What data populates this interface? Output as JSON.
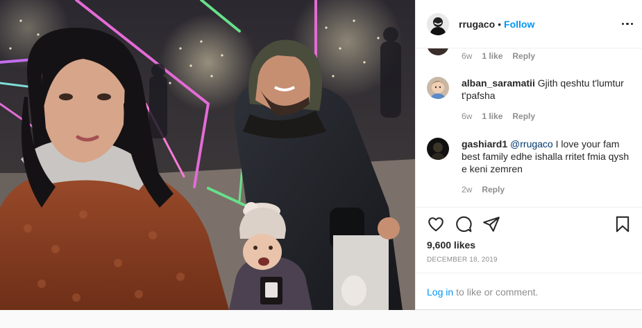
{
  "post": {
    "author": "rrugaco",
    "separator": "•",
    "follow_label": "Follow",
    "more_icon": "more-horizontal-icon"
  },
  "partial_comment": {
    "age": "6w",
    "likes": "1 like",
    "reply": "Reply"
  },
  "comments": [
    {
      "user": "alban_saramatii",
      "mention": "",
      "text": "Gjith qeshtu t'lumtur t'pafsha",
      "age": "6w",
      "likes": "1 like",
      "reply": "Reply"
    },
    {
      "user": "gashiard1",
      "mention": "@rrugaco",
      "text": "I love your fam best family edhe ishalla rritet fmia qysh e keni zemren",
      "age": "2w",
      "likes": "",
      "reply": "Reply"
    }
  ],
  "actions": {
    "icons": [
      "heart-icon",
      "comment-icon",
      "share-icon",
      "bookmark-icon"
    ],
    "likes_text": "9,600 likes",
    "date_text": "DECEMBER 18, 2019"
  },
  "login": {
    "link_text": "Log in",
    "rest_text": "to like or comment."
  },
  "colors": {
    "link_blue": "#0095f6",
    "mention_blue": "#00376b",
    "text_dark": "#262626",
    "text_muted": "#8e8e8e",
    "border": "#efefef"
  }
}
